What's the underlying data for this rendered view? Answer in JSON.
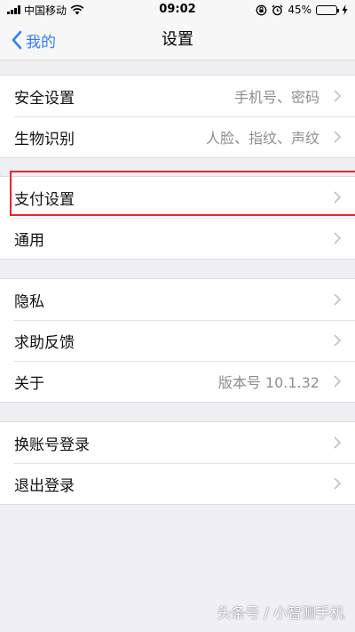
{
  "status_bar": {
    "carrier": "中国移动",
    "time": "09:02",
    "battery_percent": "45%",
    "battery_level": 0.45,
    "battery_color": "#4cd964"
  },
  "nav": {
    "back_label": "我的",
    "title": "设置",
    "accent": "#2f7df7"
  },
  "groups": [
    {
      "items": [
        {
          "label": "安全设置",
          "value": "手机号、密码"
        },
        {
          "label": "生物识别",
          "value": "人脸、指纹、声纹"
        }
      ]
    },
    {
      "items": [
        {
          "label": "支付设置",
          "value": ""
        },
        {
          "label": "通用",
          "value": ""
        }
      ]
    },
    {
      "items": [
        {
          "label": "隐私",
          "value": ""
        },
        {
          "label": "求助反馈",
          "value": ""
        },
        {
          "label": "关于",
          "value": "版本号 10.1.32"
        }
      ]
    },
    {
      "items": [
        {
          "label": "换账号登录",
          "value": ""
        },
        {
          "label": "退出登录",
          "value": ""
        }
      ]
    }
  ],
  "highlight_color": "#e8262a",
  "watermark": "头条号 / 小智测手机",
  "icons": {
    "back": "chevron-left-icon",
    "row_arrow": "chevron-right-icon",
    "wifi": "wifi-icon",
    "alarm": "alarm-icon",
    "rotation_lock": "rotation-lock-icon",
    "charging": "bolt-icon"
  }
}
